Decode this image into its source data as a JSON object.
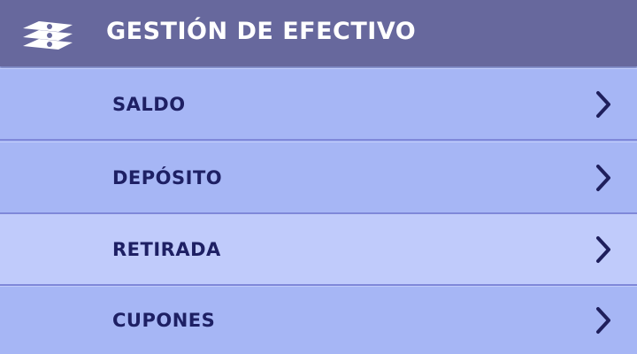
{
  "header": {
    "icon": "stacked-cash-icon",
    "title": "GESTIÓN DE EFECTIVO"
  },
  "menu": {
    "active_index": 2,
    "items": [
      {
        "label": "SALDO",
        "icon": "chevron-right-icon"
      },
      {
        "label": "DEPÓSITO",
        "icon": "chevron-right-icon"
      },
      {
        "label": "RETIRADA",
        "icon": "chevron-right-icon"
      },
      {
        "label": "CUPONES",
        "icon": "chevron-right-icon"
      }
    ]
  },
  "colors": {
    "header_bg": "#67689d",
    "item_bg": "#a6b6f5",
    "active_item_bg": "#c0cbfb",
    "text": "#1e2064",
    "chevron": "#1f1f5c"
  }
}
